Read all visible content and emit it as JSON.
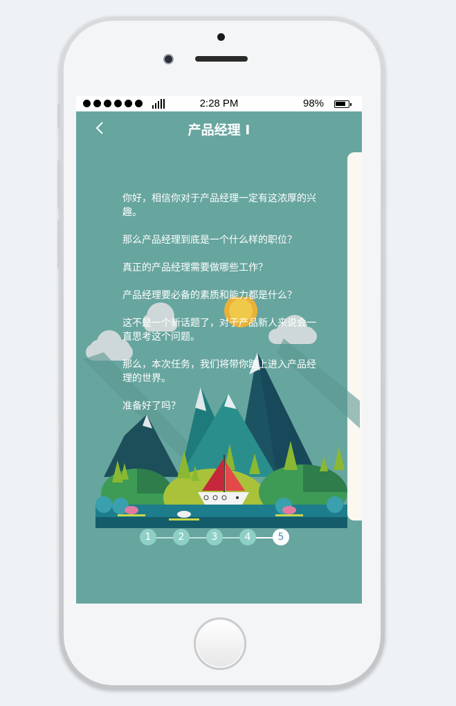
{
  "status_bar": {
    "time": "2:28  PM",
    "battery": "98%",
    "signal_icon": "signal-bars-icon",
    "battery_icon": "battery-icon"
  },
  "nav": {
    "title": "产品经理 I",
    "back_icon": "chevron-left-icon"
  },
  "content": {
    "paragraphs": [
      "你好，相信你对于产品经理一定有这浓厚的兴趣。",
      "那么产品经理到底是一个什么样的职位？",
      "真正的产品经理需要做哪些工作？",
      "产品经理要必备的素质和能力都是什么？",
      "这不是一个新话题了，对于产品新人来说会一直思考这个问题。",
      "那么，本次任务，我们将带你踏上进入产品经理的世界。",
      "准备好了吗？"
    ]
  },
  "steps": {
    "labels": [
      "1",
      "2",
      "3",
      "4",
      "5"
    ],
    "active_index": 4
  },
  "colors": {
    "screen_bg": "#67a59f",
    "step_inactive": "#8fd0c6",
    "step_active_text": "#4a8fb0",
    "card_bg": "#fbf8f1"
  }
}
